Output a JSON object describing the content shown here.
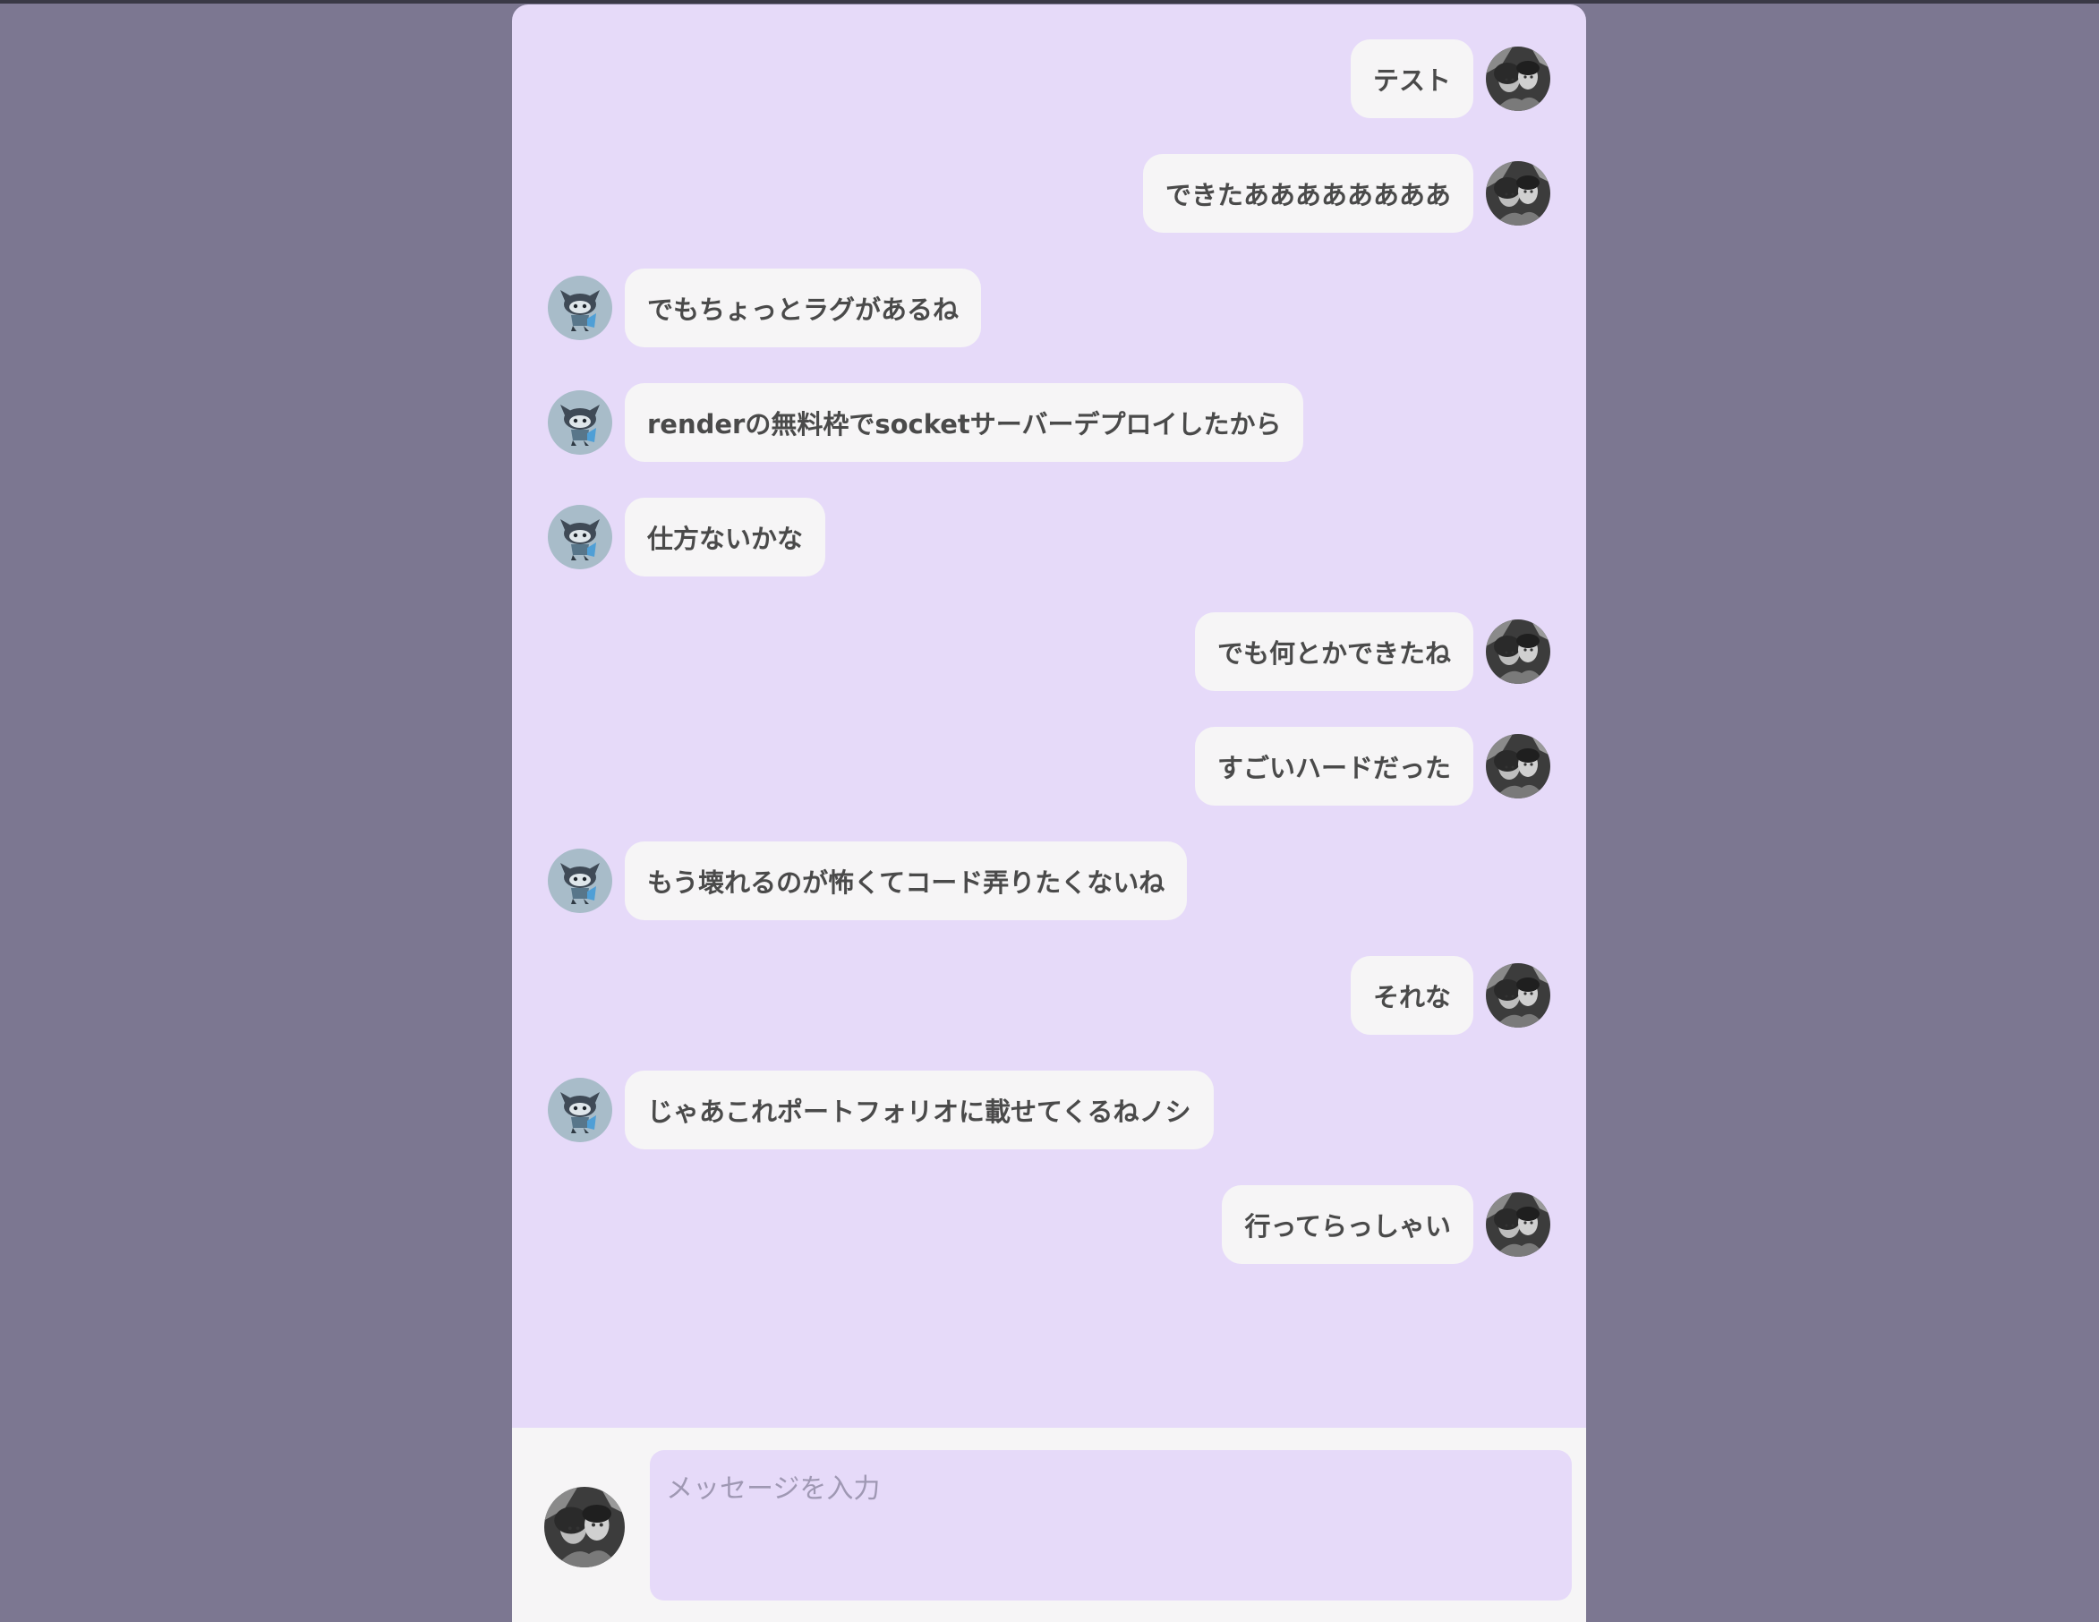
{
  "chat": {
    "messages": [
      {
        "side": "mine",
        "text": "テスト"
      },
      {
        "side": "mine",
        "text": "できたああああああああ"
      },
      {
        "side": "theirs",
        "text": "でもちょっとラグがあるね"
      },
      {
        "side": "theirs",
        "text": "renderの無料枠でsocketサーバーデプロイしたから"
      },
      {
        "side": "theirs",
        "text": "仕方ないかな"
      },
      {
        "side": "mine",
        "text": "でも何とかできたね"
      },
      {
        "side": "mine",
        "text": "すごいハードだった"
      },
      {
        "side": "theirs",
        "text": "もう壊れるのが怖くてコード弄りたくないね"
      },
      {
        "side": "mine",
        "text": "それな"
      },
      {
        "side": "theirs",
        "text": "じゃあこれポートフォリオに載せてくるねノシ"
      },
      {
        "side": "mine",
        "text": "行ってらっしゃい"
      }
    ]
  },
  "composer": {
    "placeholder": "メッセージを入力",
    "value": ""
  },
  "colors": {
    "page_background": "#7c7791",
    "chat_background": "#e6daf9",
    "bubble_background": "#f6f5f6",
    "text": "#4a4a4a"
  }
}
